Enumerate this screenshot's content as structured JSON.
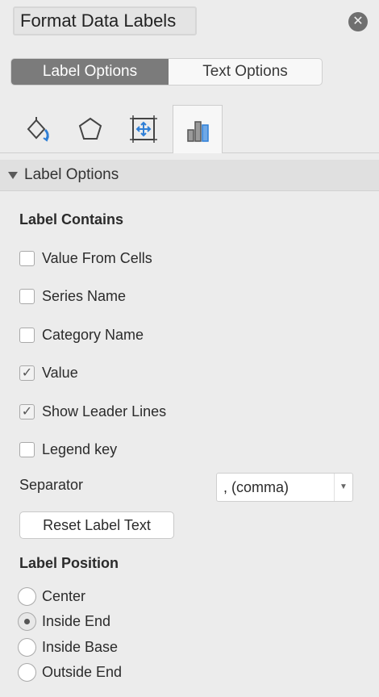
{
  "pane": {
    "title": "Format Data Labels",
    "close_icon": "close-icon"
  },
  "tabs": [
    {
      "label": "Label Options",
      "active": true
    },
    {
      "label": "Text Options",
      "active": false
    }
  ],
  "icon_tabs": [
    {
      "icon": "fill-line-icon",
      "selected": false
    },
    {
      "icon": "effects-icon",
      "selected": false
    },
    {
      "icon": "size-properties-icon",
      "selected": false
    },
    {
      "icon": "label-options-icon",
      "selected": true
    }
  ],
  "section": {
    "title": "Label Options",
    "label_contains": {
      "heading": "Label Contains",
      "items": [
        {
          "label": "Value From Cells",
          "checked": false
        },
        {
          "label": "Series Name",
          "checked": false
        },
        {
          "label": "Category Name",
          "checked": false
        },
        {
          "label": "Value",
          "checked": true
        },
        {
          "label": "Show Leader Lines",
          "checked": true
        },
        {
          "label": "Legend key",
          "checked": false
        }
      ]
    },
    "separator": {
      "label": "Separator",
      "value": ", (comma)"
    },
    "reset_label": "Reset Label Text",
    "label_position": {
      "heading": "Label Position",
      "options": [
        {
          "label": "Center",
          "selected": false
        },
        {
          "label": "Inside End",
          "selected": true
        },
        {
          "label": "Inside Base",
          "selected": false
        },
        {
          "label": "Outside End",
          "selected": false
        }
      ]
    }
  }
}
